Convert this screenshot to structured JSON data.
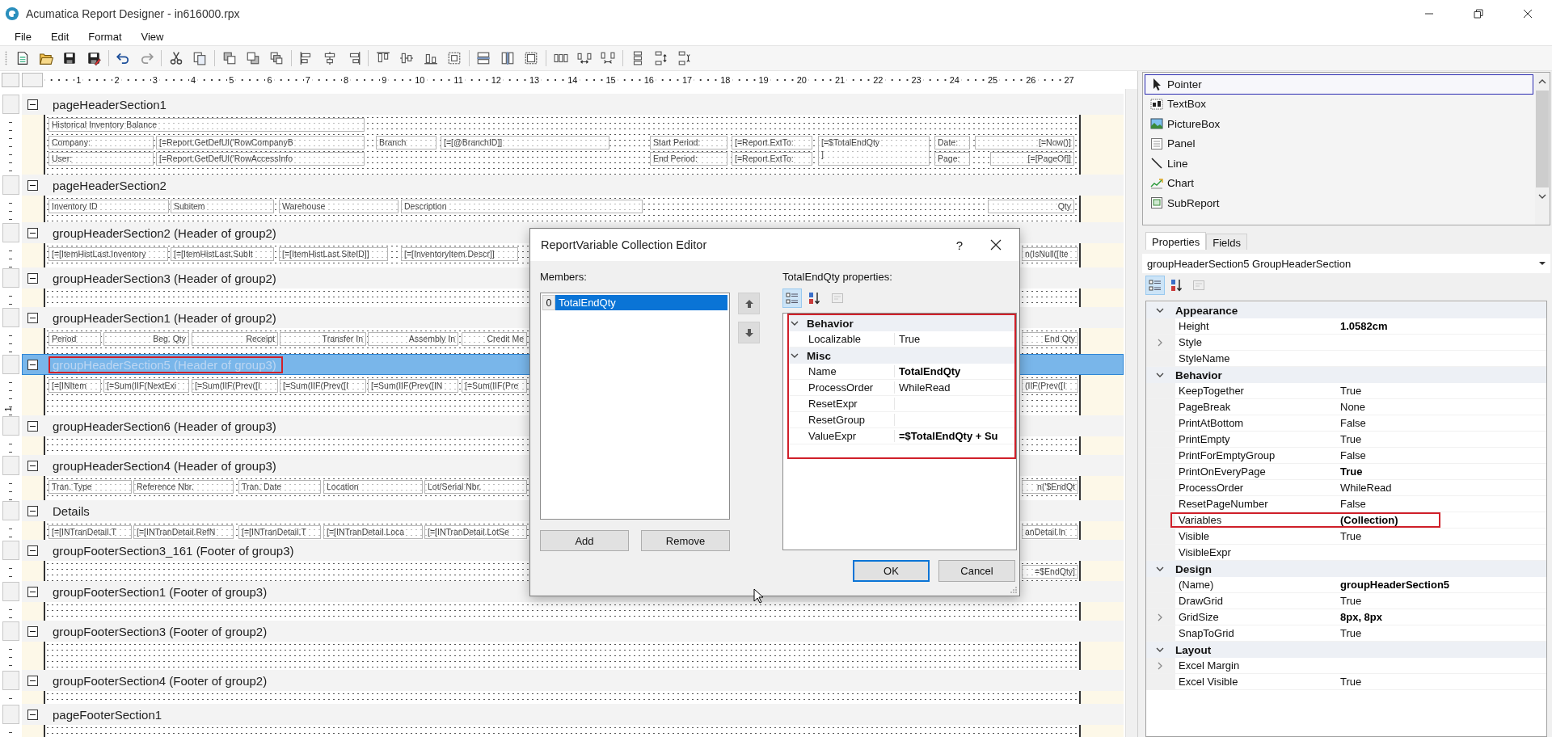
{
  "window": {
    "title": "Acumatica Report Designer - in616000.rpx"
  },
  "menu": [
    "File",
    "Edit",
    "Format",
    "View"
  ],
  "ruler": [
    "1",
    "2",
    "3",
    "4",
    "5",
    "6",
    "7",
    "8",
    "9",
    "10",
    "11",
    "12",
    "13",
    "14",
    "15",
    "16",
    "17",
    "18",
    "19",
    "20",
    "21",
    "22",
    "23",
    "24",
    "25",
    "26",
    "27"
  ],
  "sections": [
    {
      "title": "pageHeaderSection1",
      "selected": false,
      "highlighted": false,
      "fields": [
        "Historical Inventory Balance",
        "Company:",
        "[=Report.GetDefUI('RowCompanyB",
        "Branch",
        "[=[@BranchID]]",
        "Start Period:",
        "[=Report.ExtTo:",
        "[=$TotalEndQty\n]",
        "Date:",
        "[=Now()]",
        "User:",
        "[=Report.GetDefUI('RowAccessInfo",
        "End Period:",
        "[=Report.ExtTo:",
        "Page:",
        "[=[PageOf]]"
      ]
    },
    {
      "title": "pageHeaderSection2",
      "selected": false,
      "highlighted": false,
      "fields": [
        "Inventory ID",
        "Subitem",
        "Warehouse",
        "Description",
        "Qty"
      ]
    },
    {
      "title": "groupHeaderSection2 (Header of group2)",
      "selected": false,
      "highlighted": false,
      "fields": [
        "[=[ItemHistLast.Inventory",
        "[=[ItemHistLast.SubIt",
        "[=[ItemHistLast.SiteID]]",
        "[=[InventoryItem.Descr]]",
        "n(IsNull([Ite"
      ]
    },
    {
      "title": "groupHeaderSection3 (Header of group2)",
      "selected": false,
      "highlighted": false
    },
    {
      "title": "groupHeaderSection1 (Header of group2)",
      "selected": false,
      "highlighted": false,
      "fields": [
        "Period",
        "Beg. Qty",
        "Receipt",
        "Transfer In",
        "Assembly In",
        "Credit Me",
        "End Qty"
      ]
    },
    {
      "title": "groupHeaderSection5 (Header of group3)",
      "selected": true,
      "highlighted": true,
      "ruler_mark": "1",
      "fields": [
        "[=[INItem",
        "[=Sum(IIF(NextExi",
        "[=Sum(IIF(Prev([I",
        "[=Sum(IIF(Prev([I",
        "[=Sum(IIF(Prev([IN",
        "[=Sum(IIF(Pre",
        "(IIF(Prev([I"
      ]
    },
    {
      "title": "groupHeaderSection6 (Header of group3)",
      "selected": false,
      "highlighted": false
    },
    {
      "title": "groupHeaderSection4 (Header of group3)",
      "selected": false,
      "highlighted": false,
      "fields": [
        "Tran. Type",
        "Reference Nbr.",
        "Tran. Date",
        "Location",
        "Lot/Serial Nbr.",
        "n('$EndQt"
      ]
    },
    {
      "title": "Details",
      "selected": false,
      "highlighted": false,
      "fields": [
        "[=[INTranDetail.T",
        "[=[INTranDetail.RefN",
        "[=[INTranDetail.T",
        "[=[INTranDetail.Loca",
        "[=[INTranDetail.LotSe",
        "anDetail.In"
      ]
    },
    {
      "title": "groupFooterSection3_161 (Footer of group3)",
      "selected": false,
      "highlighted": false,
      "fields": [
        "=$EndQty]"
      ]
    },
    {
      "title": "groupFooterSection1 (Footer of group3)",
      "selected": false,
      "highlighted": false
    },
    {
      "title": "groupFooterSection3 (Footer of group2)",
      "selected": false,
      "highlighted": false
    },
    {
      "title": "groupFooterSection4 (Footer of group2)",
      "selected": false,
      "highlighted": false
    },
    {
      "title": "pageFooterSection1",
      "selected": false,
      "highlighted": false
    }
  ],
  "toolbox": [
    {
      "label": "Pointer",
      "selected": true
    },
    {
      "label": "TextBox",
      "selected": false
    },
    {
      "label": "PictureBox",
      "selected": false
    },
    {
      "label": "Panel",
      "selected": false
    },
    {
      "label": "Line",
      "selected": false
    },
    {
      "label": "Chart",
      "selected": false
    },
    {
      "label": "SubReport",
      "selected": false
    }
  ],
  "properties": {
    "tabs": [
      {
        "label": "Properties",
        "selected": true
      },
      {
        "label": "Fields",
        "selected": false
      }
    ],
    "object": "groupHeaderSection5 GroupHeaderSection",
    "view_buttons": [
      {
        "kind": "categorized",
        "selected": true,
        "disabled": false
      },
      {
        "kind": "alphabetical",
        "selected": false,
        "disabled": false
      },
      {
        "kind": "pages",
        "selected": false,
        "disabled": true
      }
    ],
    "categories": [
      {
        "name": "Appearance",
        "expanded": true,
        "rows": [
          {
            "name": "Height",
            "value": "1.0582cm",
            "modified": true,
            "expandable": false,
            "highlighted": false
          },
          {
            "name": "Style",
            "expandable": true,
            "highlighted": false
          },
          {
            "name": "StyleName",
            "expandable": false,
            "highlighted": false
          }
        ]
      },
      {
        "name": "Behavior",
        "expanded": true,
        "rows": [
          {
            "name": "KeepTogether",
            "value": "True",
            "modified": false,
            "expandable": false,
            "highlighted": false
          },
          {
            "name": "PageBreak",
            "value": "None",
            "modified": false,
            "expandable": false,
            "highlighted": false
          },
          {
            "name": "PrintAtBottom",
            "value": "False",
            "modified": false,
            "expandable": false,
            "highlighted": false
          },
          {
            "name": "PrintEmpty",
            "value": "True",
            "modified": false,
            "expandable": false,
            "highlighted": false
          },
          {
            "name": "PrintForEmptyGroup",
            "value": "False",
            "modified": false,
            "expandable": false,
            "highlighted": false
          },
          {
            "name": "PrintOnEveryPage",
            "value": "True",
            "modified": true,
            "expandable": false,
            "highlighted": false
          },
          {
            "name": "ProcessOrder",
            "value": "WhileRead",
            "modified": false,
            "expandable": false,
            "highlighted": false
          },
          {
            "name": "ResetPageNumber",
            "value": "False",
            "modified": false,
            "expandable": false,
            "highlighted": false
          },
          {
            "name": "Variables",
            "value": "(Collection)",
            "modified": true,
            "expandable": false,
            "highlighted": true
          },
          {
            "name": "Visible",
            "value": "True",
            "modified": false,
            "expandable": false,
            "highlighted": false
          },
          {
            "name": "VisibleExpr",
            "expandable": false,
            "highlighted": false
          }
        ]
      },
      {
        "name": "Design",
        "expanded": true,
        "rows": [
          {
            "name": "(Name)",
            "value": "groupHeaderSection5",
            "modified": true,
            "expandable": false,
            "highlighted": false
          },
          {
            "name": "DrawGrid",
            "value": "True",
            "modified": false,
            "expandable": false,
            "highlighted": false
          },
          {
            "name": "GridSize",
            "value": "8px, 8px",
            "modified": true,
            "expandable": true,
            "highlighted": false
          },
          {
            "name": "SnapToGrid",
            "value": "True",
            "modified": false,
            "expandable": false,
            "highlighted": false
          }
        ]
      },
      {
        "name": "Layout",
        "expanded": true,
        "rows": [
          {
            "name": "Excel Margin",
            "expandable": true,
            "highlighted": false
          },
          {
            "name": "Excel Visible",
            "value": "True",
            "modified": false,
            "expandable": false,
            "highlighted": false
          }
        ]
      }
    ]
  },
  "dialog": {
    "title": "ReportVariable Collection Editor",
    "help": "?",
    "members_label": "Members:",
    "members": [
      {
        "index": "0",
        "name": "TotalEndQty",
        "selected": true
      }
    ],
    "properties_label": "TotalEndQty properties:",
    "view_buttons": [
      {
        "kind": "categorized",
        "selected": true,
        "disabled": false
      },
      {
        "kind": "alphabetical",
        "selected": false,
        "disabled": false
      },
      {
        "kind": "pages",
        "selected": false,
        "disabled": true
      }
    ],
    "grid": {
      "highlighted": true,
      "categories": [
        {
          "name": "Behavior",
          "expanded": true,
          "rows": [
            {
              "name": "Localizable",
              "value": "True",
              "modified": false
            }
          ]
        },
        {
          "name": "Misc",
          "expanded": true,
          "rows": [
            {
              "name": "Name",
              "value": "TotalEndQty",
              "modified": true
            },
            {
              "name": "ProcessOrder",
              "value": "WhileRead",
              "modified": false
            },
            {
              "name": "ResetExpr"
            },
            {
              "name": "ResetGroup"
            },
            {
              "name": "ValueExpr",
              "value": "=$TotalEndQty + Su",
              "modified": true
            }
          ]
        }
      ]
    },
    "list_buttons": [
      "Add",
      "Remove"
    ],
    "buttons": [
      {
        "label": "OK",
        "default": true
      },
      {
        "label": "Cancel",
        "default": false
      }
    ]
  }
}
